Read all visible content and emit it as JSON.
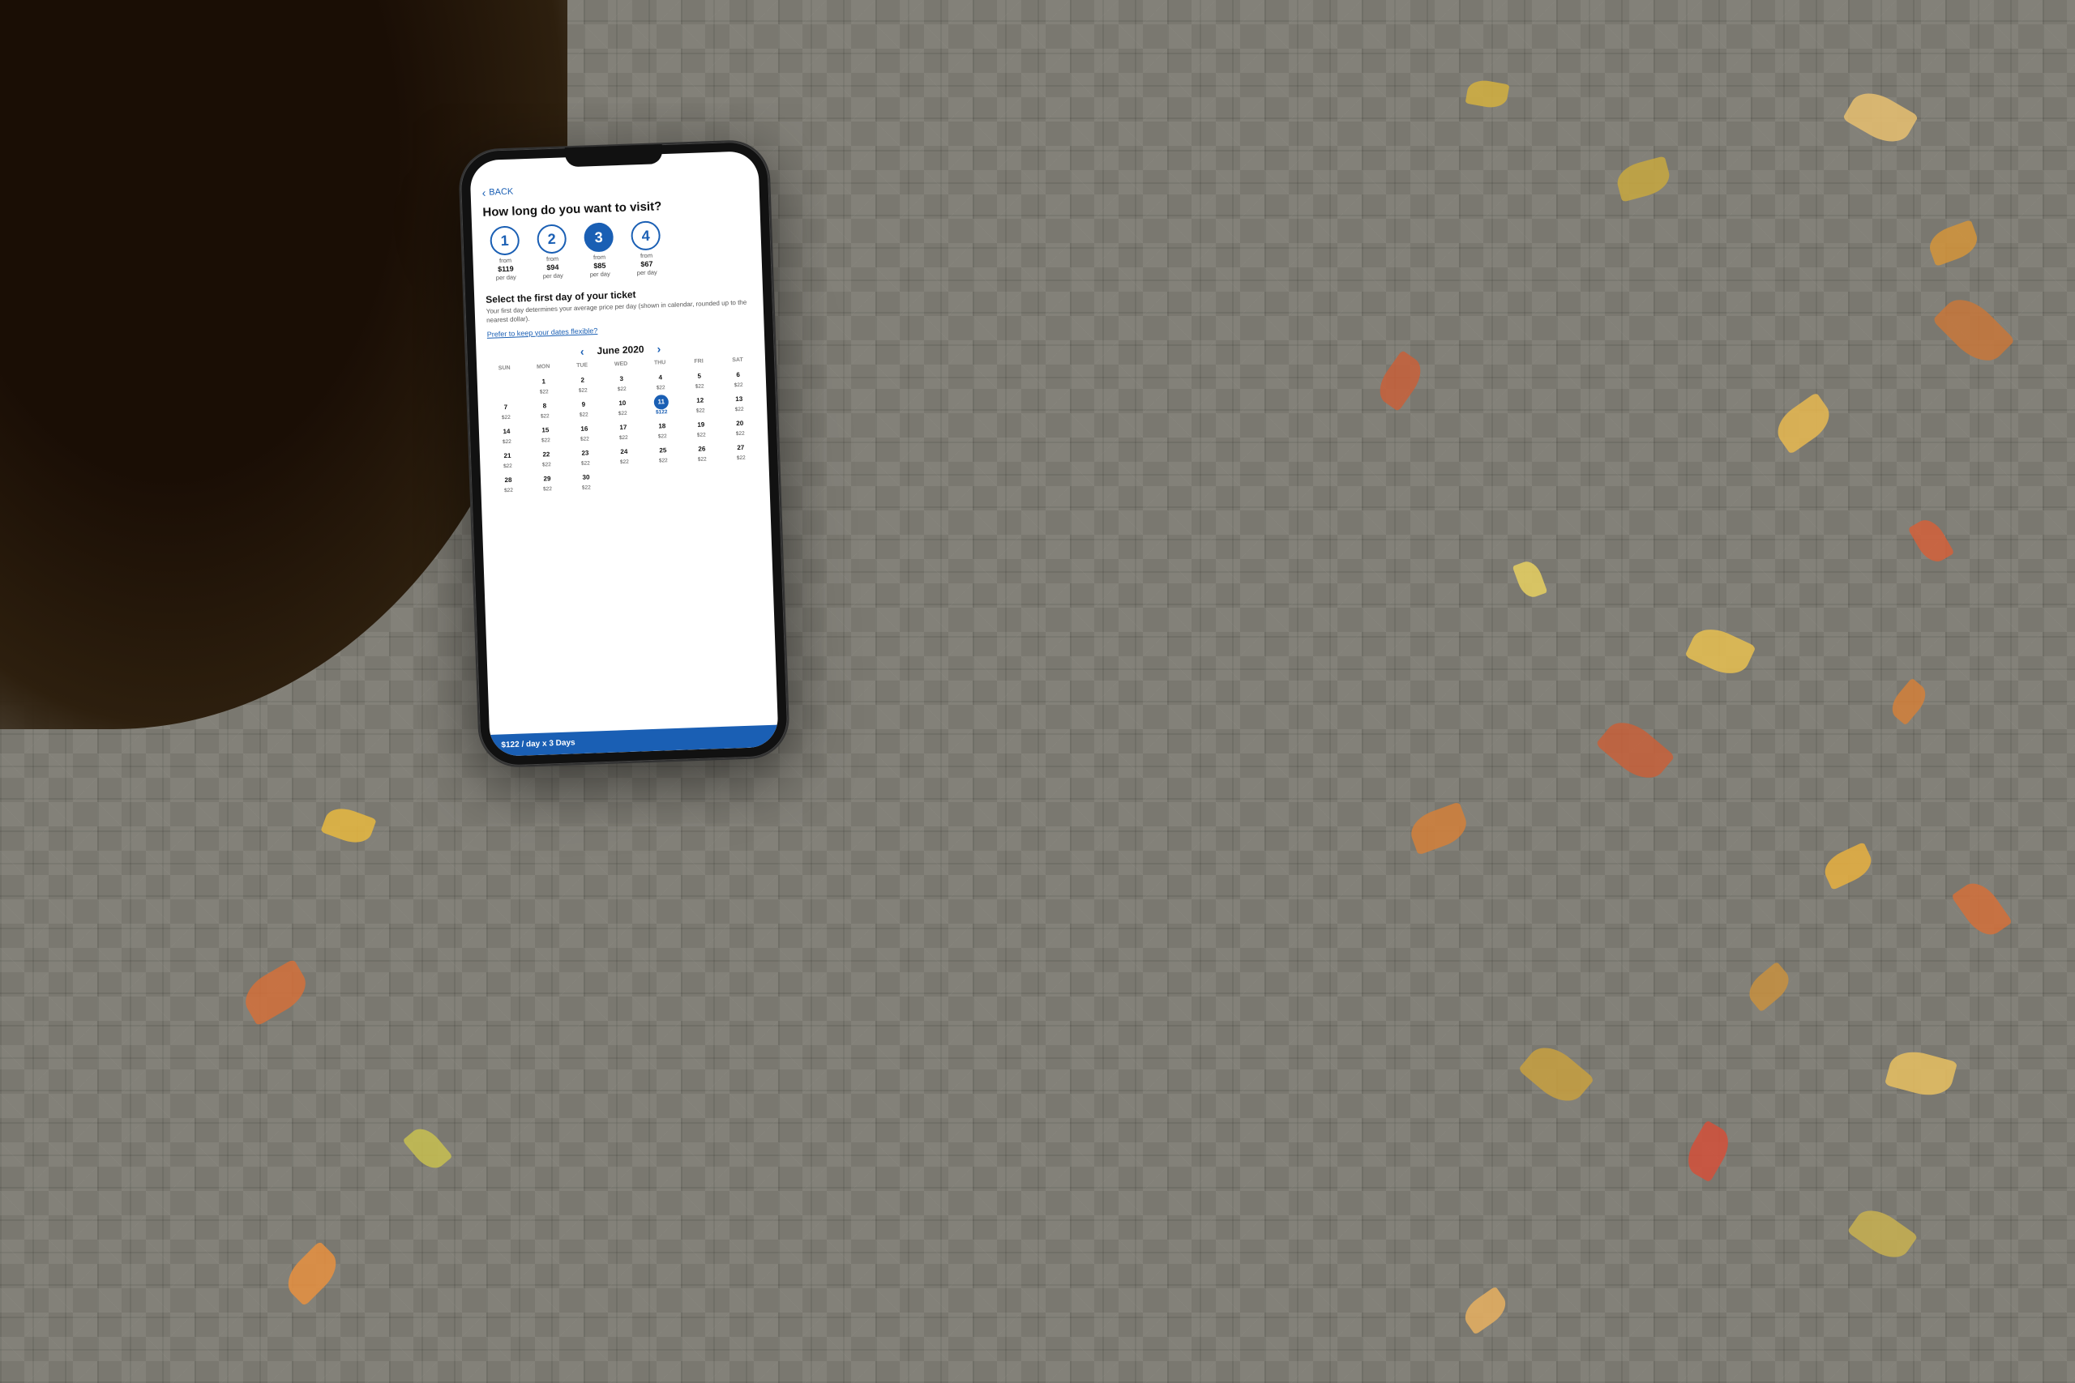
{
  "scene": {
    "background_color": "#7a7870"
  },
  "app": {
    "back_label": "BACK",
    "question": "How long do you want to visit?",
    "day_options": [
      {
        "days": "1",
        "from": "from",
        "price": "$119",
        "per_day": "per day",
        "selected": false
      },
      {
        "days": "2",
        "from": "from",
        "price": "$94",
        "per_day": "per day",
        "selected": false
      },
      {
        "days": "3",
        "from": "from",
        "price": "$85",
        "per_day": "per day",
        "selected": true
      },
      {
        "days": "4",
        "from": "from",
        "price": "$67",
        "per_day": "per day",
        "selected": false
      }
    ],
    "section_title": "Select the first day of your ticket",
    "section_desc": "Your first day determines your average price per day (shown in calendar, rounded up to the nearest dollar).",
    "flexible_link": "Prefer to keep your dates flexible?",
    "calendar": {
      "month_year": "June 2020",
      "day_headers": [
        "SUN",
        "MON",
        "TUE",
        "WED",
        "THU",
        "FRI",
        "SAT"
      ],
      "weeks": [
        [
          {
            "date": "",
            "price": ""
          },
          {
            "date": "1",
            "price": "$22"
          },
          {
            "date": "2",
            "price": "$22"
          },
          {
            "date": "3",
            "price": "$22"
          },
          {
            "date": "4",
            "price": "$22"
          },
          {
            "date": "5",
            "price": "$22"
          },
          {
            "date": "6",
            "price": "$22"
          }
        ],
        [
          {
            "date": "7",
            "price": "$22"
          },
          {
            "date": "8",
            "price": "$22"
          },
          {
            "date": "9",
            "price": "$22"
          },
          {
            "date": "10",
            "price": "$22"
          },
          {
            "date": "11",
            "price": "$122",
            "selected": true
          },
          {
            "date": "12",
            "price": "$22"
          },
          {
            "date": "13",
            "price": "$22"
          }
        ],
        [
          {
            "date": "14",
            "price": "$22"
          },
          {
            "date": "15",
            "price": "$22"
          },
          {
            "date": "16",
            "price": "$22"
          },
          {
            "date": "17",
            "price": "$22"
          },
          {
            "date": "18",
            "price": "$22"
          },
          {
            "date": "19",
            "price": "$22"
          },
          {
            "date": "20",
            "price": "$22"
          }
        ],
        [
          {
            "date": "21",
            "price": "$22"
          },
          {
            "date": "22",
            "price": "$22"
          },
          {
            "date": "23",
            "price": "$22"
          },
          {
            "date": "24",
            "price": "$22"
          },
          {
            "date": "25",
            "price": "$22"
          },
          {
            "date": "26",
            "price": "$22"
          },
          {
            "date": "27",
            "price": "$22"
          }
        ],
        [
          {
            "date": "28",
            "price": "$22"
          },
          {
            "date": "29",
            "price": "$22"
          },
          {
            "date": "30",
            "price": "$22"
          },
          {
            "date": "",
            "price": ""
          },
          {
            "date": "",
            "price": ""
          },
          {
            "date": "",
            "price": ""
          },
          {
            "date": "",
            "price": ""
          }
        ]
      ]
    },
    "bottom_bar": {
      "text": "$122 / day x 3 Days"
    }
  }
}
